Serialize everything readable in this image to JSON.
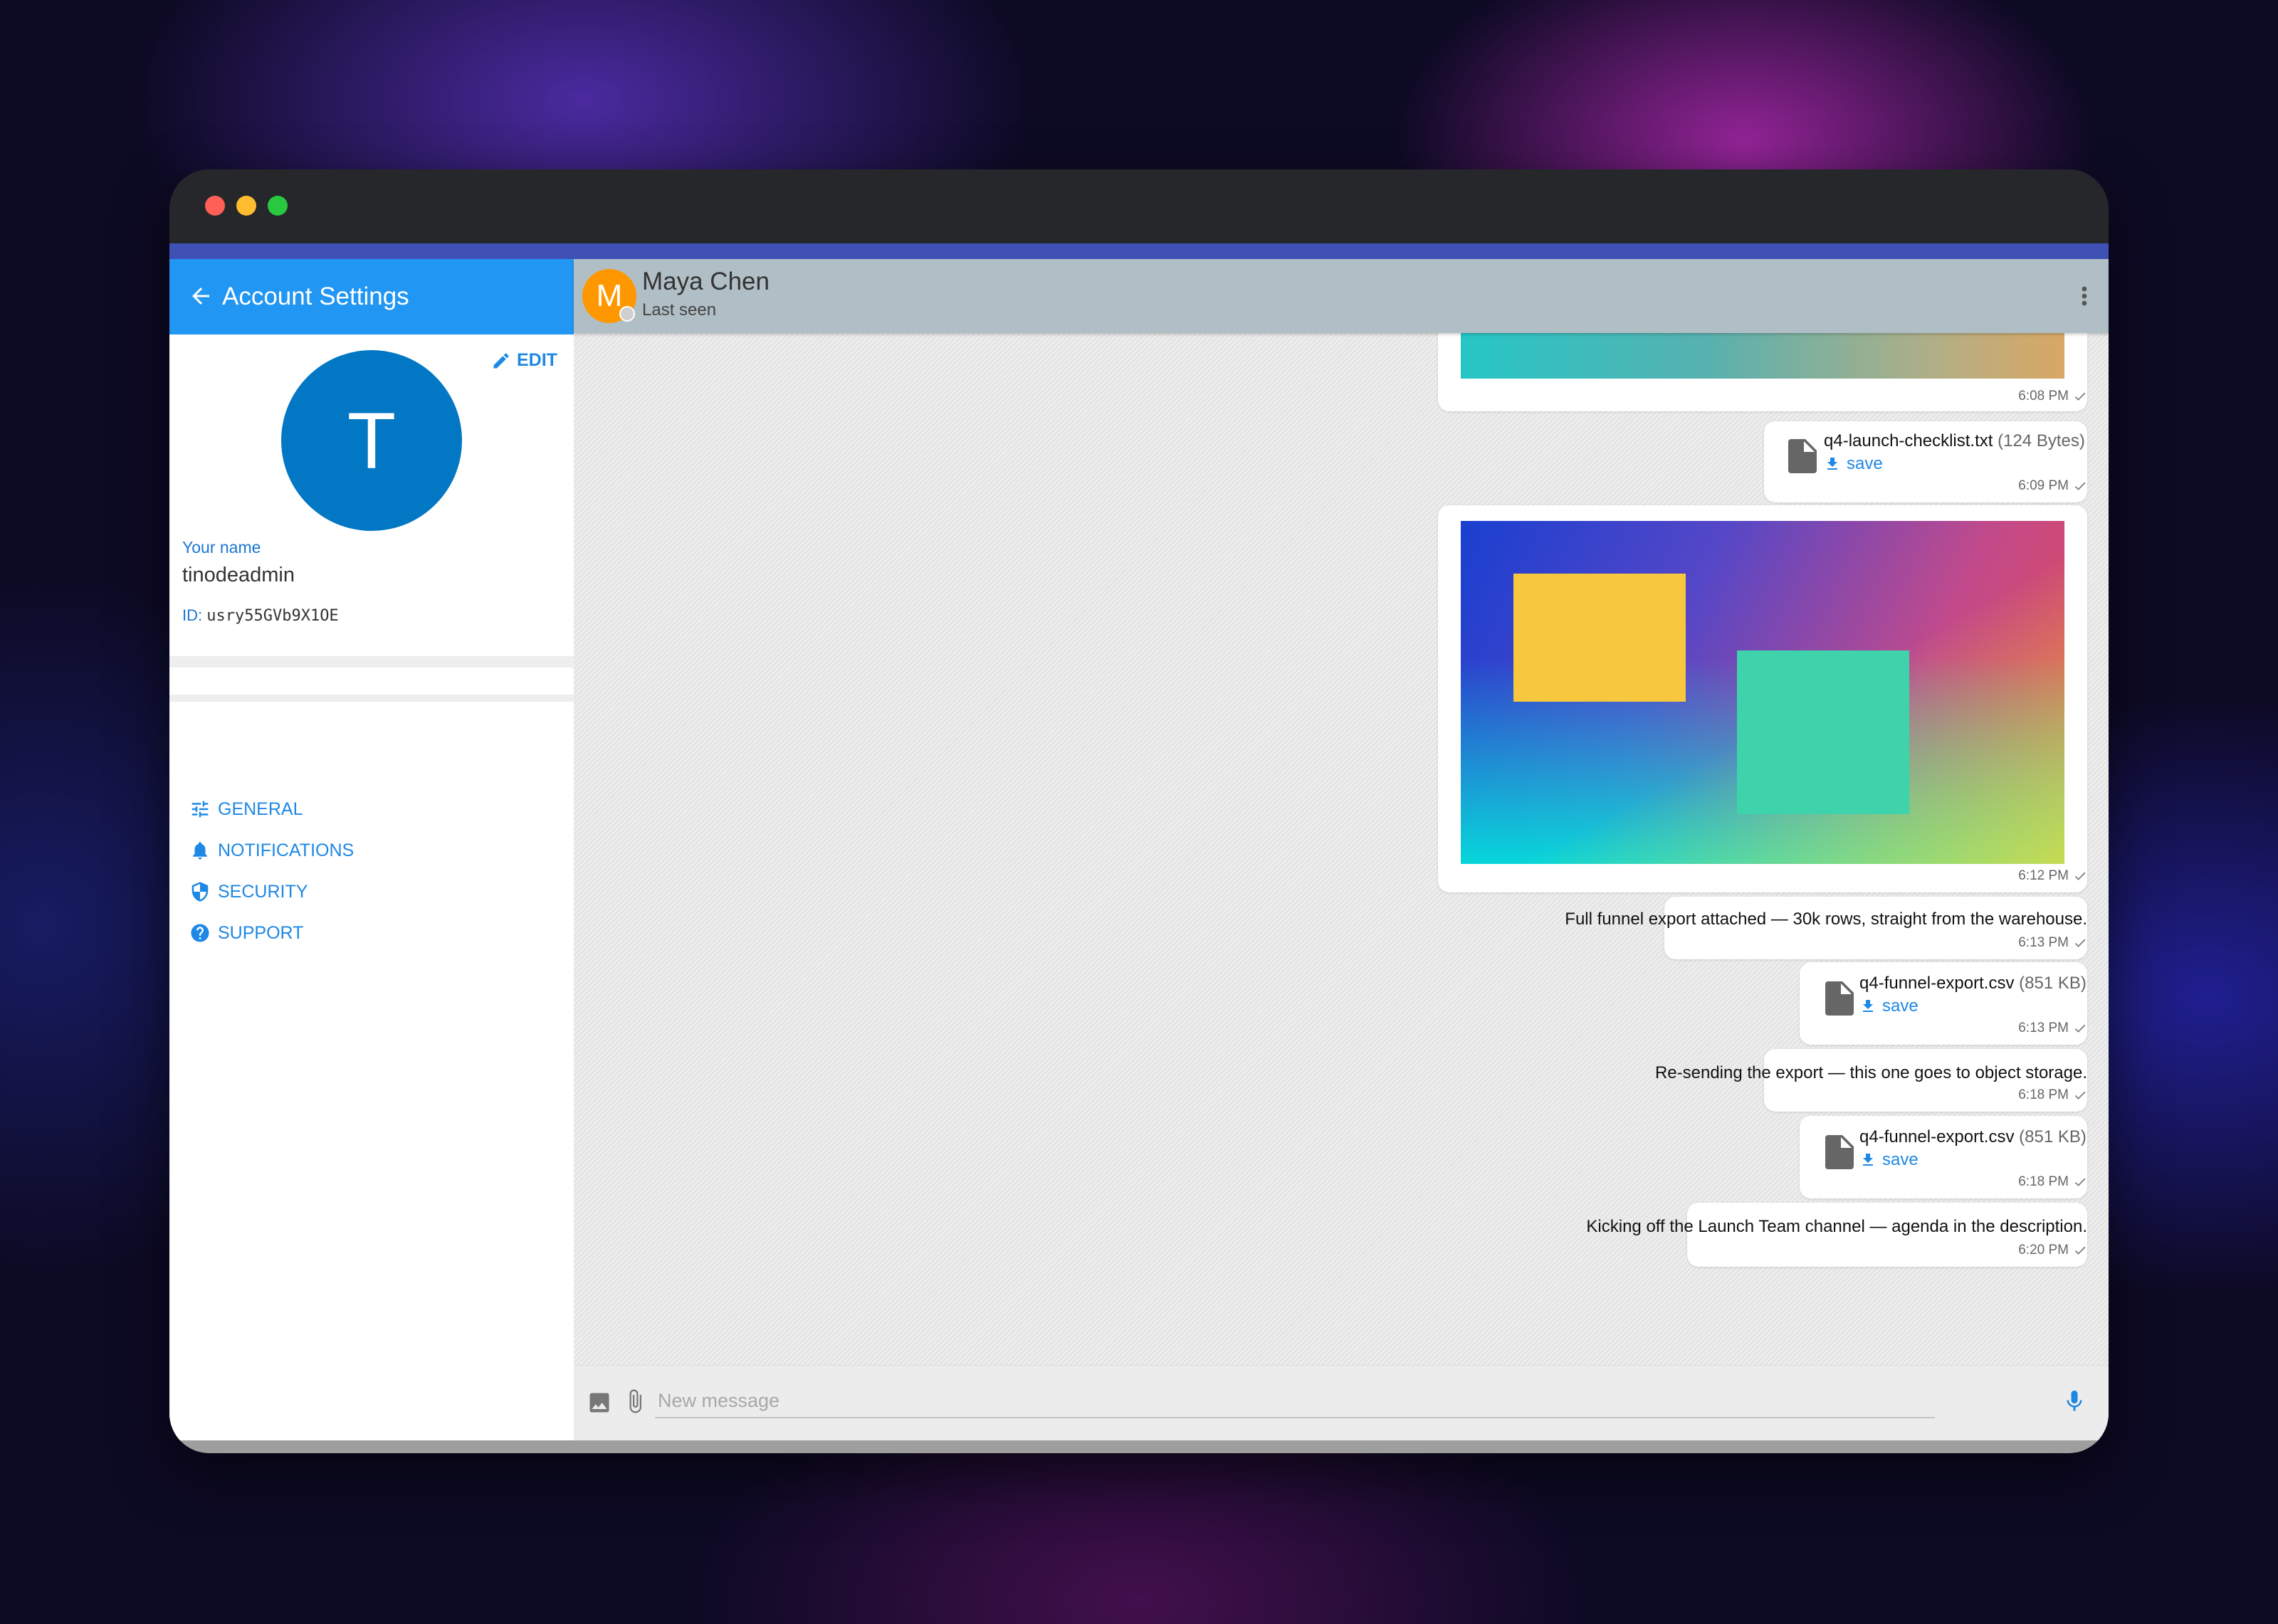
{
  "window": {
    "traffic_lights": [
      "close",
      "minimize",
      "zoom"
    ]
  },
  "colors": {
    "accent": "#2196f3",
    "header_strip": "#3f51b5",
    "avatar_user": "#0277c4",
    "avatar_peer": "#ff9800",
    "chat_header": "#b0bec5"
  },
  "sidebar": {
    "title": "Account Settings",
    "edit_label": "EDIT",
    "avatar_letter": "T",
    "your_name_label": "Your name",
    "name": "tinodeadmin",
    "id_label": "ID:",
    "id_value": "usry55GVb9X1OE",
    "menu": [
      {
        "label": "GENERAL",
        "icon": "tune-icon"
      },
      {
        "label": "NOTIFICATIONS",
        "icon": "bell-icon"
      },
      {
        "label": "SECURITY",
        "icon": "shield-icon"
      },
      {
        "label": "SUPPORT",
        "icon": "help-icon"
      }
    ]
  },
  "chat": {
    "peer_initial": "M",
    "peer_name": "Maya Chen",
    "peer_status": "Last seen",
    "messages": [
      {
        "type": "image",
        "time": "6:08 PM"
      },
      {
        "type": "file",
        "filename": "q4-launch-checklist.txt",
        "size": "(124 Bytes)",
        "action": "save",
        "time": "6:09 PM"
      },
      {
        "type": "image",
        "time": "6:12 PM"
      },
      {
        "type": "text",
        "text": "Full funnel export attached — 30k rows, straight from the warehouse.",
        "time": "6:13 PM"
      },
      {
        "type": "file",
        "filename": "q4-funnel-export.csv",
        "size": "(851 KB)",
        "action": "save",
        "time": "6:13 PM"
      },
      {
        "type": "text",
        "text": "Re-sending the export — this one goes to object storage.",
        "time": "6:18 PM"
      },
      {
        "type": "file",
        "filename": "q4-funnel-export.csv",
        "size": "(851 KB)",
        "action": "save",
        "time": "6:18 PM"
      },
      {
        "type": "text",
        "text": "Kicking off the Launch Team channel — agenda in the description.",
        "time": "6:20 PM"
      }
    ],
    "composer": {
      "placeholder": "New message"
    }
  }
}
